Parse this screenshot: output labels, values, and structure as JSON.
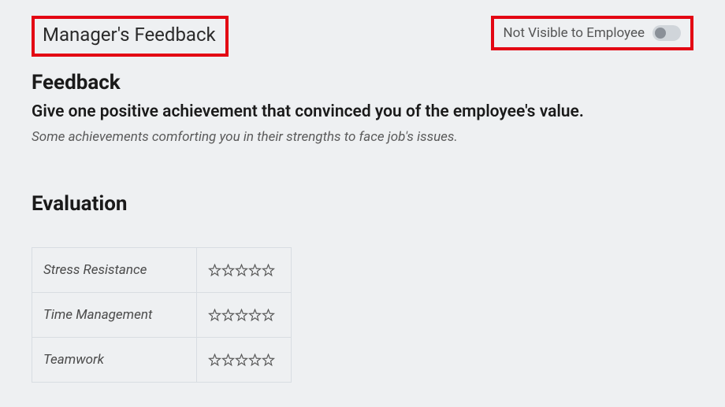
{
  "header": {
    "title": "Manager's Feedback",
    "visibility_label": "Not Visible to Employee",
    "visibility_enabled": false
  },
  "feedback": {
    "heading": "Feedback",
    "prompt": "Give one positive achievement that convinced you of the employee's value.",
    "hint": "Some achievements comforting you in their strengths to face job's issues."
  },
  "evaluation": {
    "heading": "Evaluation",
    "criteria": [
      {
        "label": "Stress Resistance",
        "rating": 0
      },
      {
        "label": "Time Management",
        "rating": 0
      },
      {
        "label": "Teamwork",
        "rating": 0
      }
    ]
  }
}
